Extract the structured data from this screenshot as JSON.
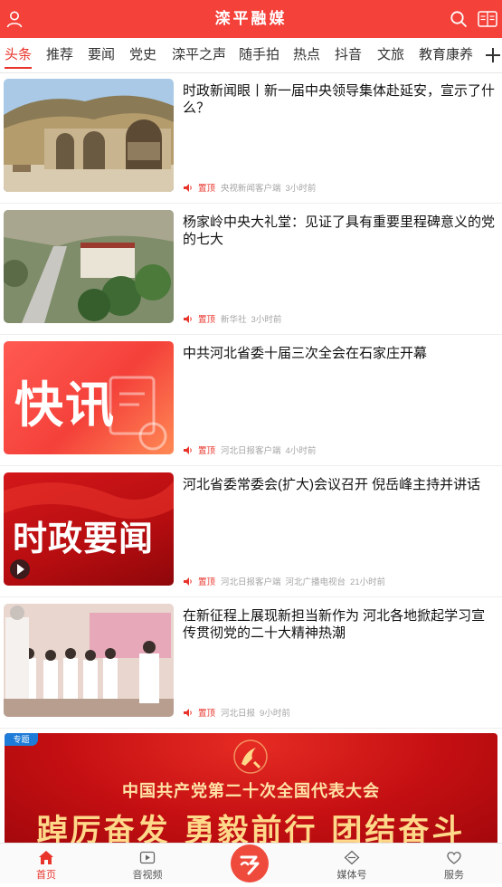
{
  "header": {
    "title": "滦平融媒"
  },
  "tabs": [
    "头条",
    "推荐",
    "要闻",
    "党史",
    "滦平之声",
    "随手拍",
    "热点",
    "抖音",
    "文旅",
    "教育康养"
  ],
  "articles": [
    {
      "headline": "时政新闻眼丨新一届中央领导集体赴延安，宣示了什么？",
      "pin": "置顶",
      "source": "央视新闻客户端",
      "source2": "",
      "time": "3小时前"
    },
    {
      "headline": "杨家岭中央大礼堂：见证了具有重要里程碑意义的党的七大",
      "pin": "置顶",
      "source": "新华社",
      "source2": "",
      "time": "3小时前"
    },
    {
      "headline": "中共河北省委十届三次全会在石家庄开幕",
      "pin": "置顶",
      "source": "河北日报客户端",
      "source2": "",
      "time": "4小时前",
      "thumb_text": "快讯"
    },
    {
      "headline": "河北省委常委会(扩大)会议召开 倪岳峰主持并讲话",
      "pin": "置顶",
      "source": "河北日报客户端",
      "source2": "河北广播电视台",
      "time": "21小时前",
      "thumb_text": "时政要闻"
    },
    {
      "headline": "在新征程上展现新担当新作为 河北各地掀起学习宣传贯彻党的二十大精神热潮",
      "pin": "置顶",
      "source": "河北日报",
      "source2": "",
      "time": "9小时前"
    }
  ],
  "banner": {
    "tag": "专题",
    "line1": "中国共产党第二十次全国代表大会",
    "line2": "踔厉奋发 勇毅前行 团结奋斗"
  },
  "bottom_nav": {
    "home": "首页",
    "video": "音视频",
    "media": "媒体号",
    "service": "服务"
  },
  "colors": {
    "brand": "#f4413a",
    "accent": "#e8342b"
  }
}
